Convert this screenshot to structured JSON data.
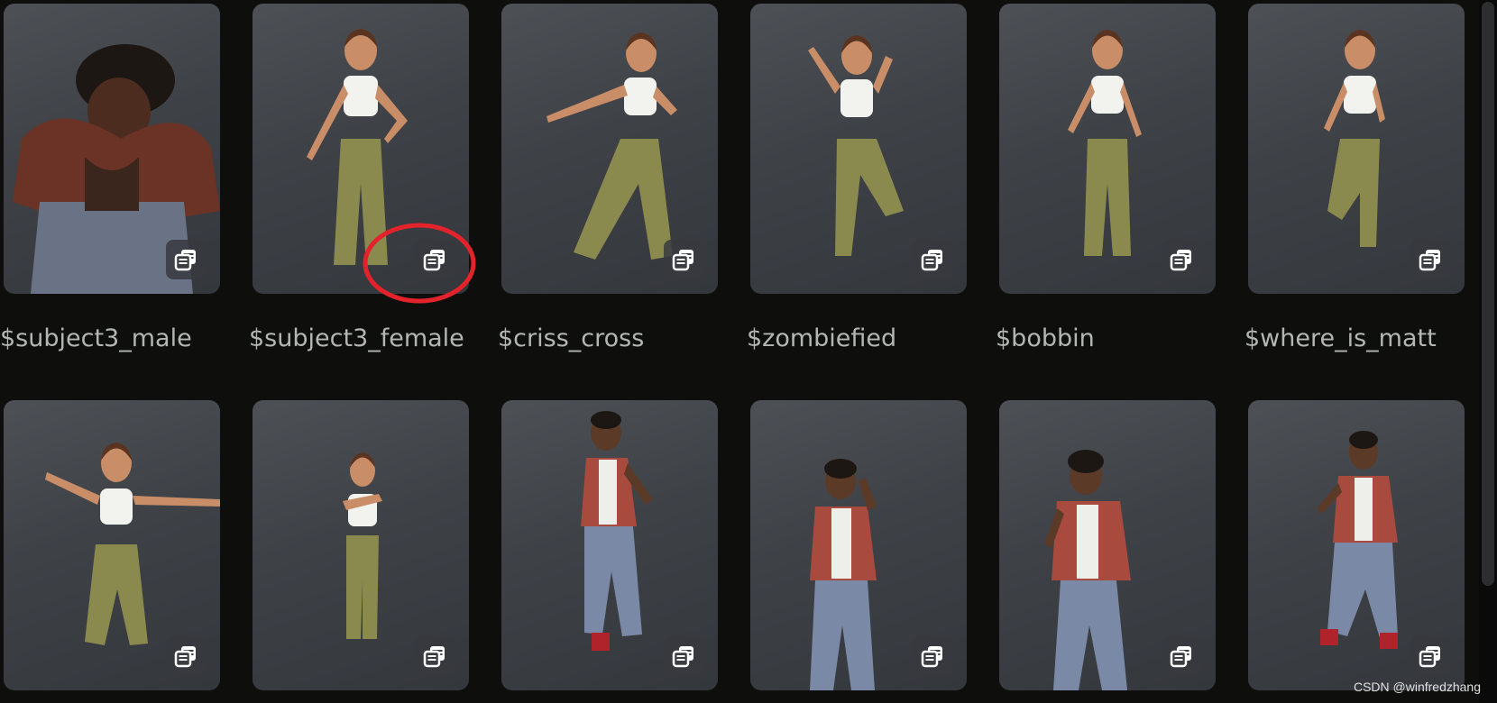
{
  "cards": [
    {
      "label": "$subject3_male",
      "figure": "male-rust-vest"
    },
    {
      "label": "$subject3_female",
      "figure": "female-cargo"
    },
    {
      "label": "$criss_cross",
      "figure": "female-cargo"
    },
    {
      "label": "$zombiefied",
      "figure": "female-cargo"
    },
    {
      "label": "$bobbin",
      "figure": "female-cargo"
    },
    {
      "label": "$where_is_matt",
      "figure": "female-cargo"
    },
    {
      "label": "",
      "figure": "female-cargo"
    },
    {
      "label": "",
      "figure": "female-cargo"
    },
    {
      "label": "",
      "figure": "male-rust-vest"
    },
    {
      "label": "",
      "figure": "male-rust-vest"
    },
    {
      "label": "",
      "figure": "male-rust-vest"
    },
    {
      "label": "",
      "figure": "male-rust-vest"
    }
  ],
  "copy_icon": "copy-icon",
  "annotation_color": "#e3232b",
  "watermark": "CSDN @winfredzhang"
}
